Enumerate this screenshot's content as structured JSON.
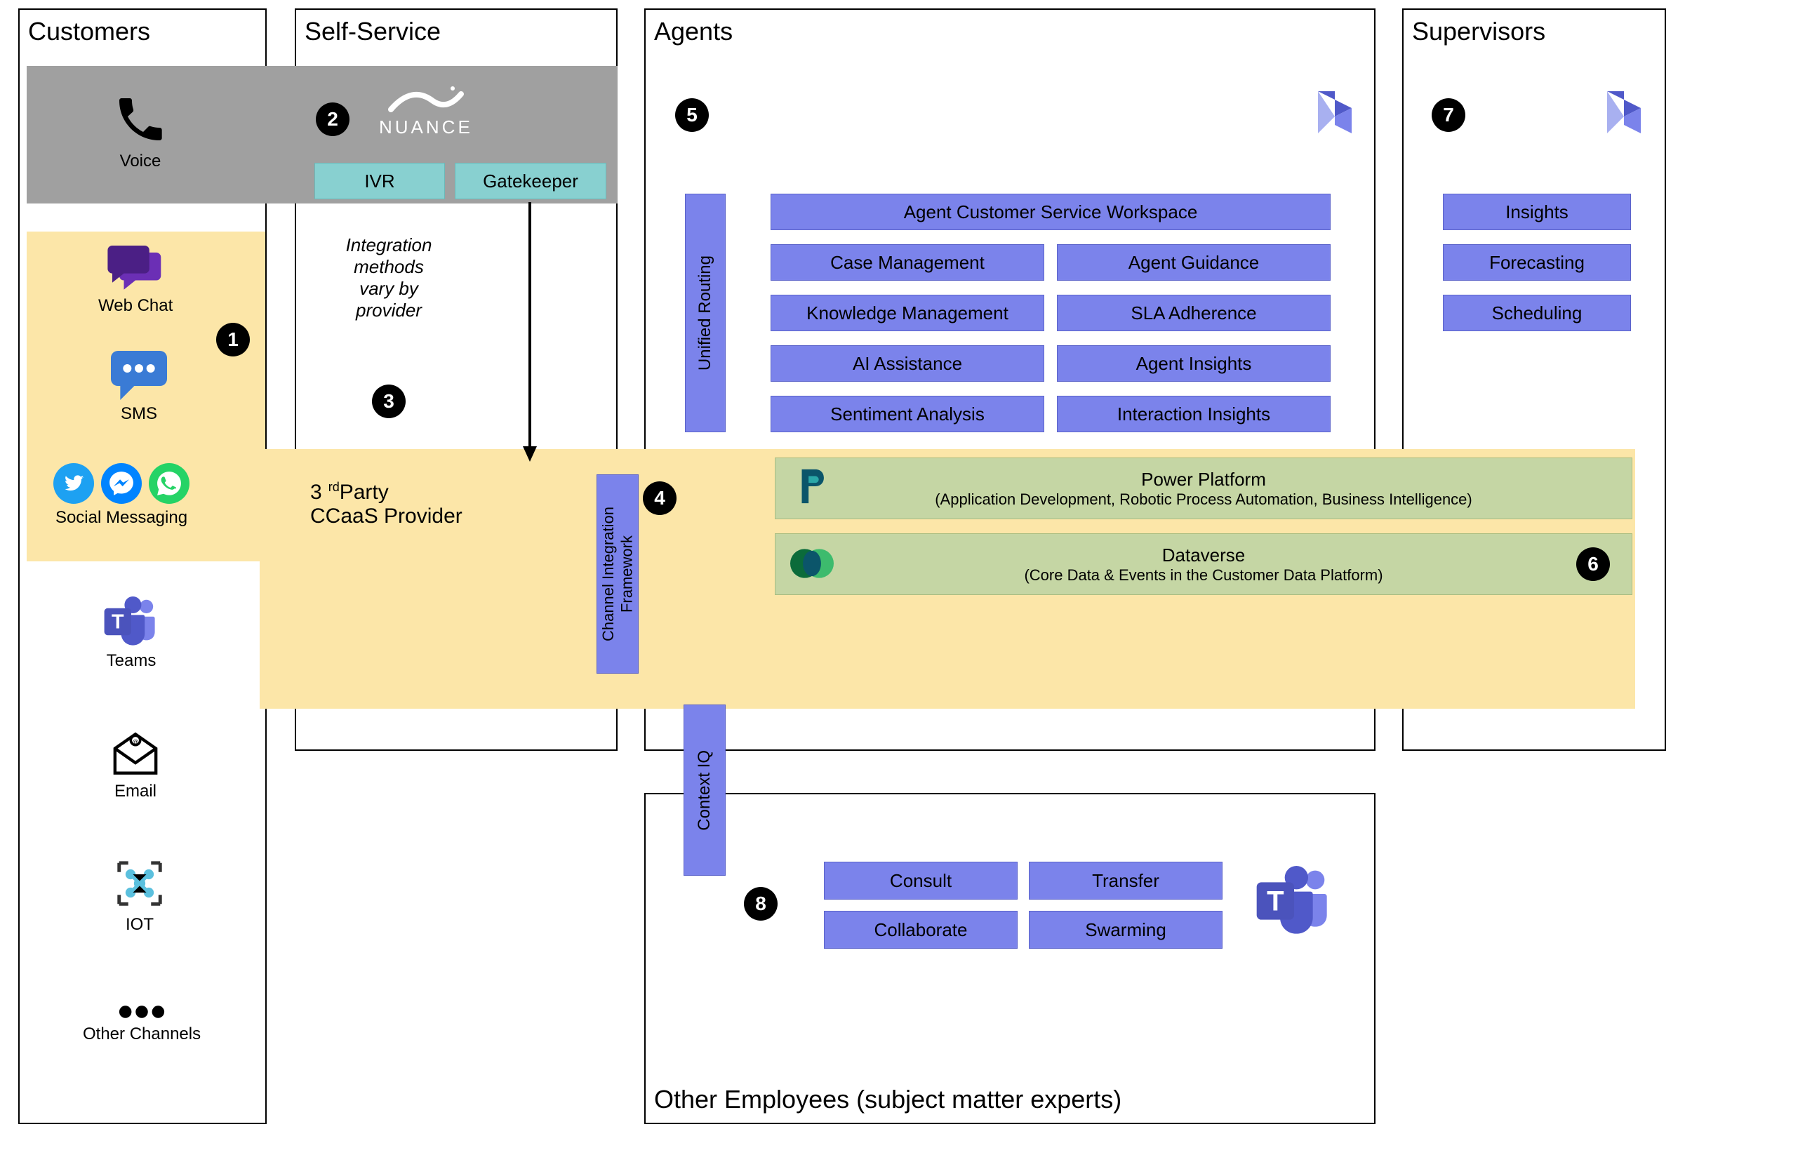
{
  "panels": {
    "customers": "Customers",
    "selfservice": "Self-Service",
    "agents": "Agents",
    "supervisors": "Supervisors",
    "other_employees": "Other Employees (subject matter experts)"
  },
  "channels": {
    "voice": "Voice",
    "webchat": "Web Chat",
    "sms": "SMS",
    "social": "Social Messaging",
    "teams": "Teams",
    "email": "Email",
    "iot": "IOT",
    "other": "Other Channels"
  },
  "selfservice": {
    "brand": "NUANCE",
    "ivr": "IVR",
    "gatekeeper": "Gatekeeper",
    "note_l1": "Integration",
    "note_l2": "methods",
    "note_l3": "vary by",
    "note_l4": "provider",
    "ccaas_l1": "3   Party",
    "ccaas_rd": "rd",
    "ccaas_l2": "CCaaS Provider"
  },
  "connectors": {
    "cif_l1": "Channel Integration",
    "cif_l2": "Framework",
    "contextiq": "Context IQ"
  },
  "agents": {
    "routing": "Unified Routing",
    "workspace": "Agent Customer Service Workspace",
    "left": [
      "Case Management",
      "Knowledge Management",
      "AI Assistance",
      "Sentiment Analysis"
    ],
    "right": [
      "Agent Guidance",
      "SLA Adherence",
      "Agent Insights",
      "Interaction Insights"
    ]
  },
  "platform": {
    "pp_title": "Power Platform",
    "pp_sub": "(Application Development, Robotic Process Automation, Business Intelligence)",
    "dv_title": "Dataverse",
    "dv_sub": "(Core Data & Events in the Customer Data Platform)"
  },
  "supervisors": {
    "items": [
      "Insights",
      "Forecasting",
      "Scheduling"
    ]
  },
  "other": {
    "tl": "Consult",
    "tr": "Transfer",
    "bl": "Collaborate",
    "br": "Swarming"
  },
  "badges": {
    "b1": "1",
    "b2": "2",
    "b3": "3",
    "b4": "4",
    "b5": "5",
    "b6": "6",
    "b7": "7",
    "b8": "8"
  }
}
